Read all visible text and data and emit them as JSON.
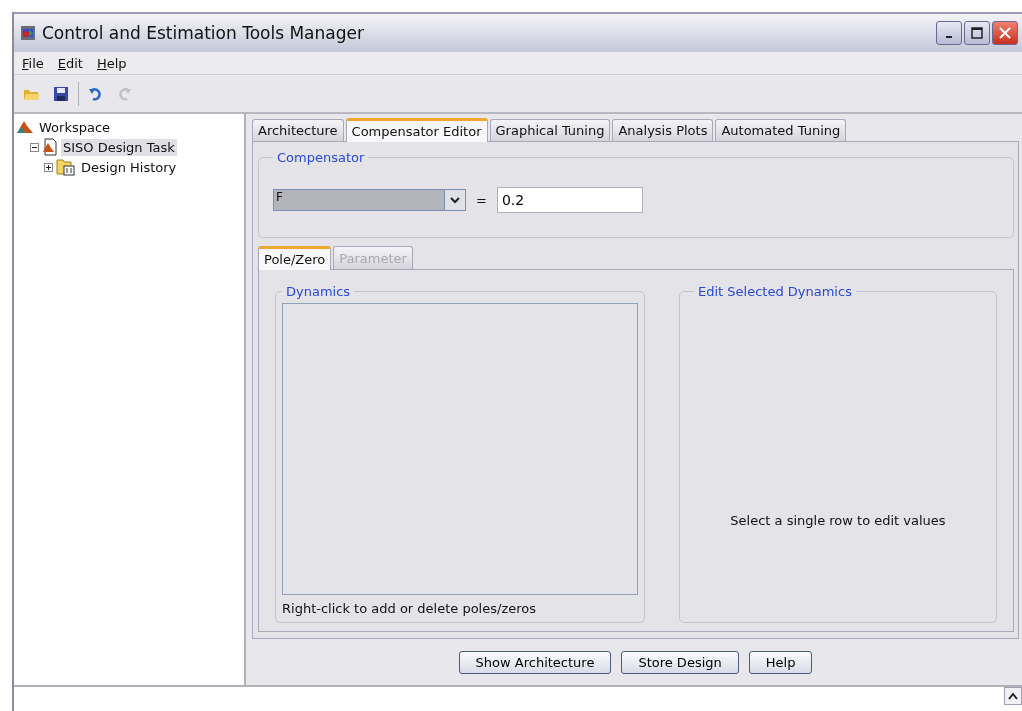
{
  "window": {
    "title": "Control and Estimation Tools Manager"
  },
  "menu": [
    {
      "label": "File"
    },
    {
      "label": "Edit"
    },
    {
      "label": "Help"
    }
  ],
  "toolbar": [
    {
      "kind": "open",
      "disabled": false
    },
    {
      "kind": "save",
      "disabled": false
    },
    {
      "kind": "undo",
      "disabled": false
    },
    {
      "kind": "redo",
      "disabled": true
    }
  ],
  "tree": [
    {
      "label": "Workspace",
      "kind": "workspace",
      "selected": false,
      "expanded": true,
      "children": [
        {
          "label": "SISO Design Task",
          "kind": "task",
          "selected": true,
          "expanded": true,
          "children": [
            {
              "label": "Design History",
              "kind": "folder",
              "selected": false,
              "expanded": false
            }
          ]
        }
      ]
    }
  ],
  "tabs": [
    {
      "label": "Architecture",
      "selected": false
    },
    {
      "label": "Compensator Editor",
      "selected": true
    },
    {
      "label": "Graphical Tuning",
      "selected": false
    },
    {
      "label": "Analysis Plots",
      "selected": false
    },
    {
      "label": "Automated Tuning",
      "selected": false
    }
  ],
  "compensator": {
    "title": "Compensator",
    "dropdown": "F",
    "equals": "=",
    "value": "0.2"
  },
  "subtabs": [
    {
      "label": "Pole/Zero",
      "selected": true,
      "disabled": false
    },
    {
      "label": "Parameter",
      "selected": false,
      "disabled": true
    }
  ],
  "dynamics": {
    "title": "Dynamics",
    "hint": "Right-click to add or delete poles/zeros"
  },
  "edit_dynamics": {
    "title": "Edit Selected Dynamics",
    "message": "Select a single row to edit values"
  },
  "buttons": [
    "Show Architecture",
    "Store Design",
    "Help"
  ]
}
